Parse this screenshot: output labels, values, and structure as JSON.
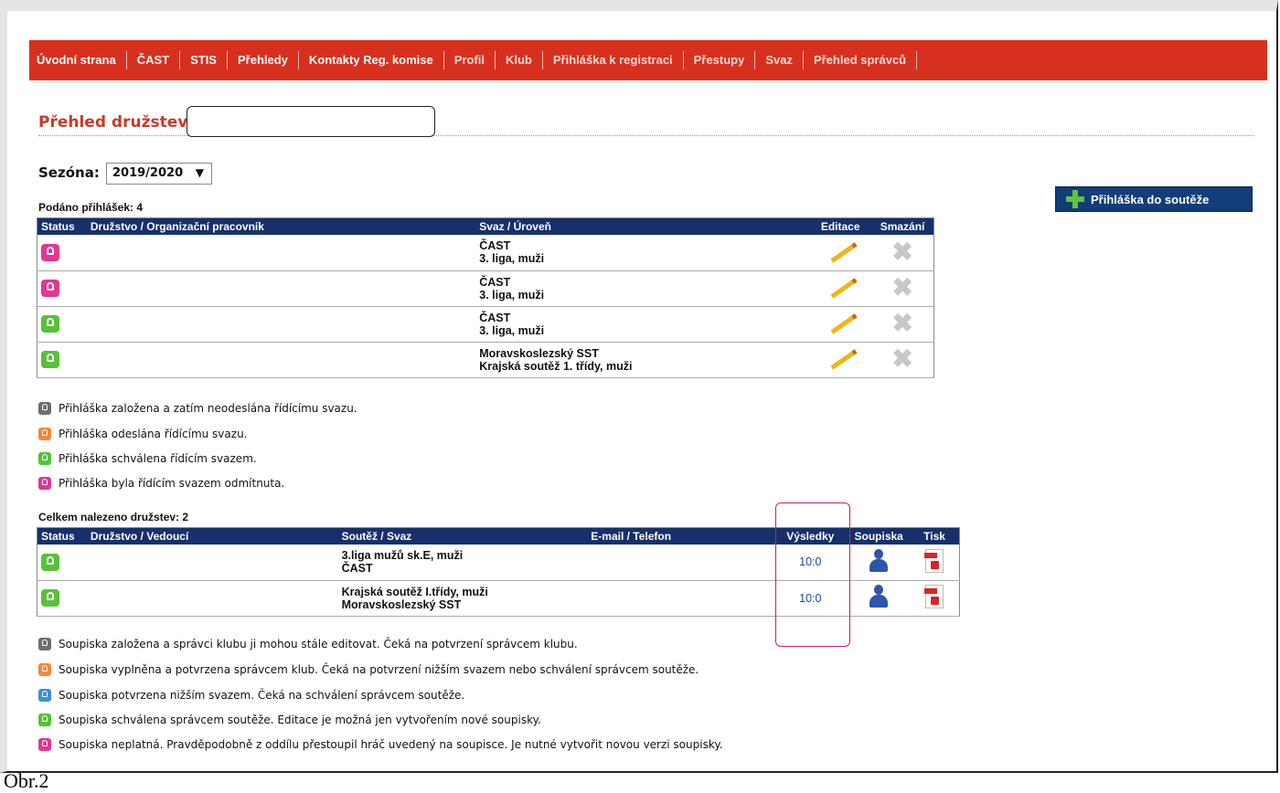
{
  "nav": [
    "Úvodní strana",
    "ČAST",
    "STIS",
    "Přehledy",
    "Kontakty Reg. komise",
    "Profil",
    "Klub",
    "Přihláška k registraci",
    "Přestupy",
    "Svaz",
    "Přehled správců"
  ],
  "page_title": "Přehled družstev",
  "season": {
    "label": "Sezóna:",
    "value": "2019/2020"
  },
  "apply_button": "Přihláška do soutěže",
  "applications": {
    "count_label": "Podáno přihlášek: 4",
    "headers": [
      "Status",
      "Družstvo / Organizační pracovník",
      "Svaz / Úroveň",
      "Editace",
      "Smazání"
    ],
    "rows": [
      {
        "status": "pink",
        "svaz": "ČAST",
        "uroven": "3. liga, muži"
      },
      {
        "status": "pink",
        "svaz": "ČAST",
        "uroven": "3. liga, muži"
      },
      {
        "status": "green",
        "svaz": "ČAST",
        "uroven": "3. liga, muži"
      },
      {
        "status": "green",
        "svaz": "Moravskoslezský SST",
        "uroven": "Krajská soutěž 1. třídy, muži"
      }
    ]
  },
  "app_legend": [
    {
      "color": "gray",
      "text": "Přihláška založena a zatím neodeslána řídícímu svazu."
    },
    {
      "color": "orange",
      "text": "Přihláška odeslána řídícímu svazu."
    },
    {
      "color": "green",
      "text": "Přihláška schválena řídícím svazem."
    },
    {
      "color": "pink",
      "text": "Přihláška byla řídícím svazem odmítnuta."
    }
  ],
  "teams": {
    "count_label": "Celkem nalezeno družstev: 2",
    "headers": [
      "Status",
      "Družstvo / Vedoucí",
      "Soutěž / Svaz",
      "E-mail / Telefon",
      "Výsledky",
      "Soupiska",
      "Tisk"
    ],
    "rows": [
      {
        "status": "green",
        "soutez": "3.liga mužů sk.E, muži",
        "svaz": "ČAST",
        "vysledky": "10:0"
      },
      {
        "status": "green",
        "soutez": "Krajská soutěž I.třídy, muži",
        "svaz": "Moravskoslezský SST",
        "vysledky": "10:0"
      }
    ]
  },
  "roster_legend": [
    {
      "color": "gray",
      "text": "Soupiska založena a správci klubu ji mohou stále editovat. Čeká na potvrzení správcem klubu."
    },
    {
      "color": "orange",
      "text": "Soupiska vyplněna a potvrzena správcem klub. Čeká na potvrzení nižším svazem nebo schválení správcem soutěže."
    },
    {
      "color": "blue",
      "text": "Soupiska potvrzena nižším svazem. Čeká na schválení správcem soutěže."
    },
    {
      "color": "green",
      "text": "Soupiska schválena správcem soutěže. Editace je možná jen vytvořením nové soupisky."
    },
    {
      "color": "pink",
      "text": "Soupiska neplatná. Pravděpodobně z oddílu přestoupil hráč uvedený na soupisce. Je nutné vytvořit novou verzi soupisky."
    }
  ],
  "caption": "Obr.2"
}
